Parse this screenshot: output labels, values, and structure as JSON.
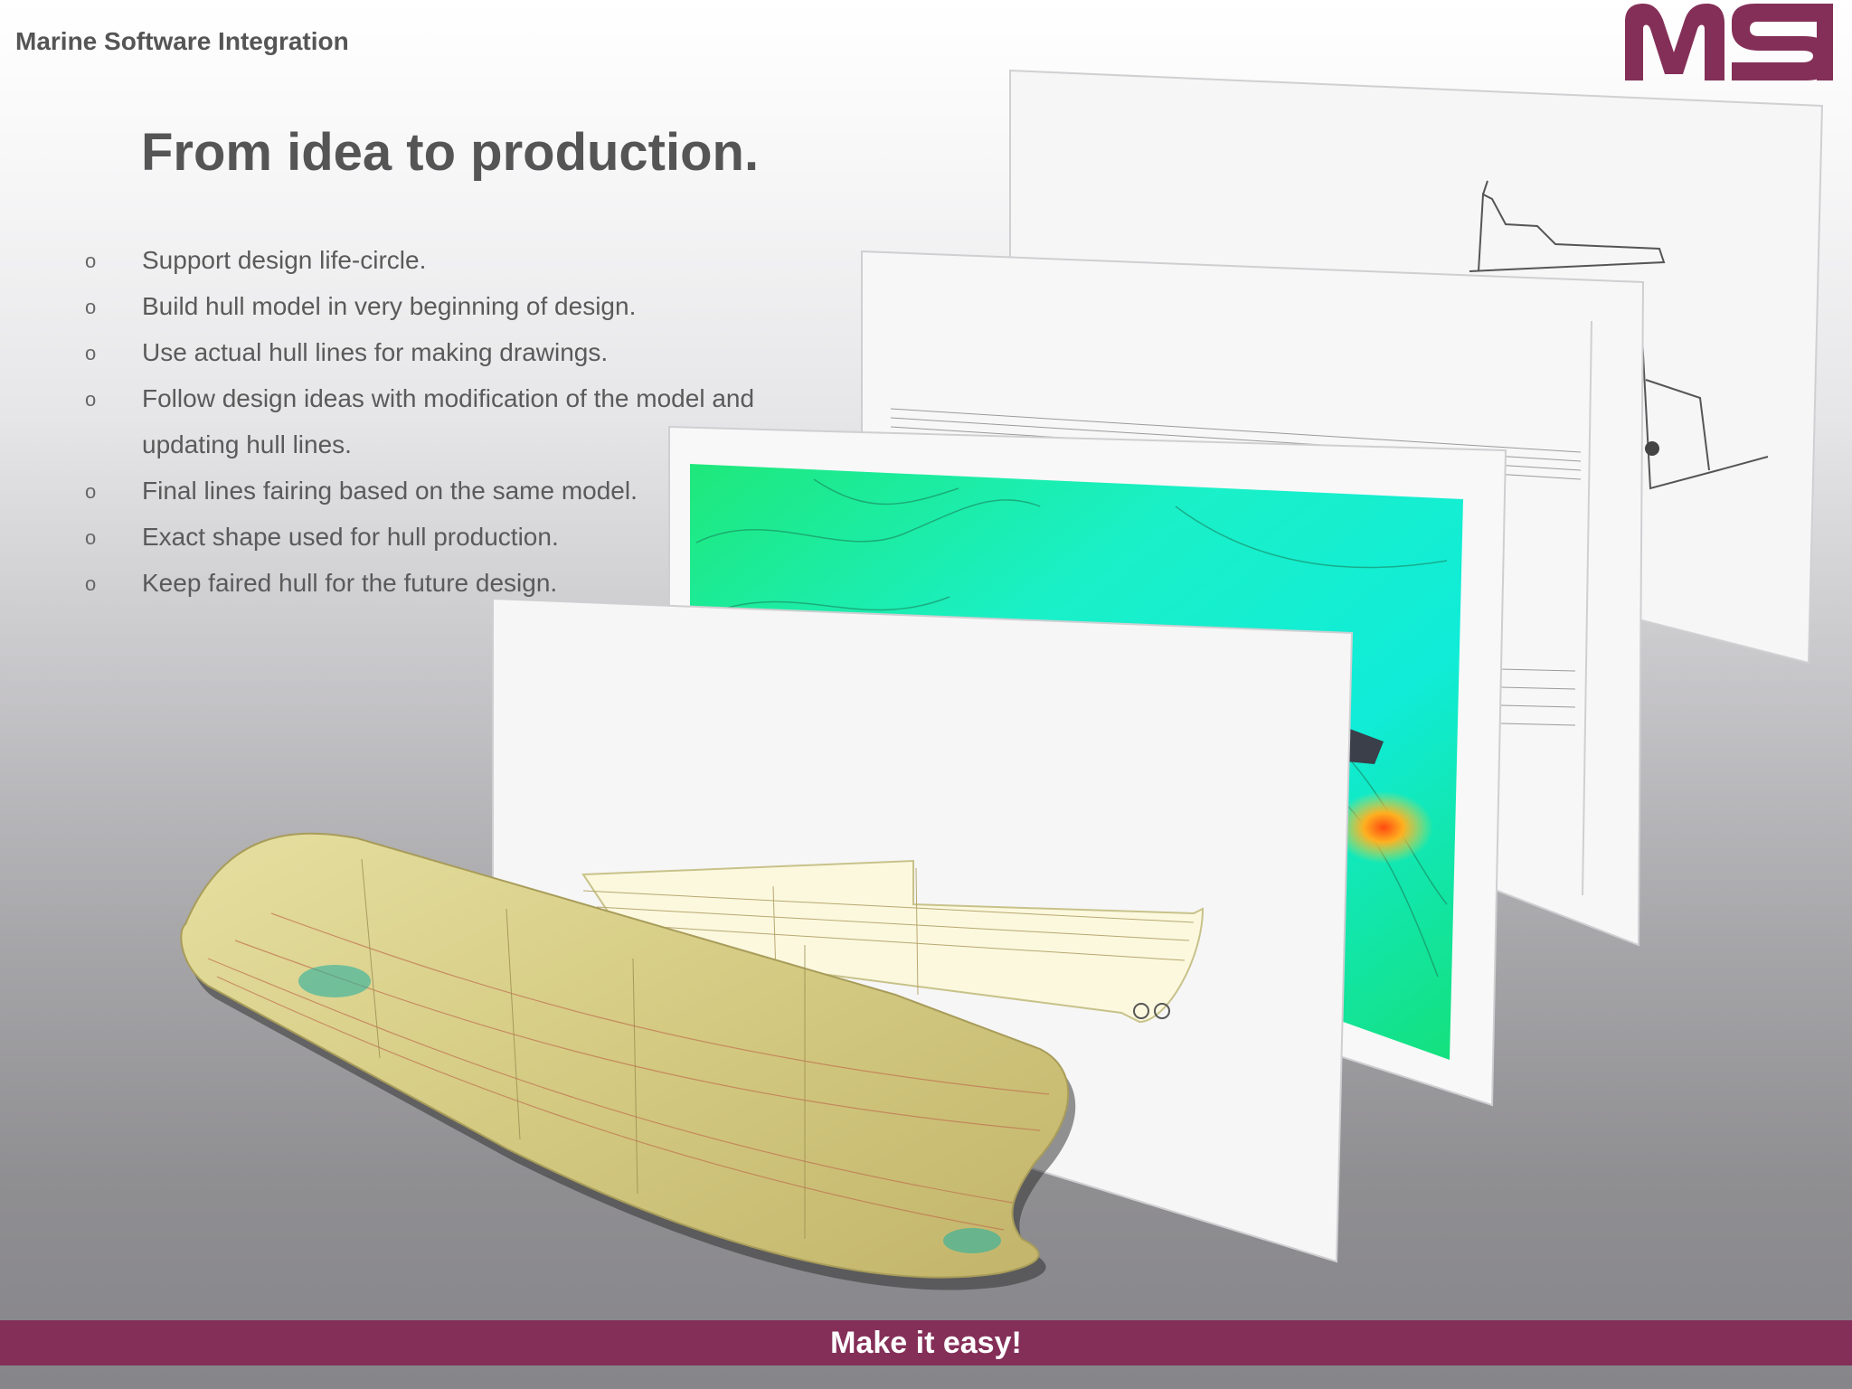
{
  "header": {
    "company": "Marine Software Integration"
  },
  "title": "From idea to production.",
  "bullets": [
    {
      "text": "Support design life-circle."
    },
    {
      "text": "Build hull model in very beginning of design."
    },
    {
      "text": "Use actual hull lines for making drawings."
    },
    {
      "text": "Follow design ideas with modification of the model and"
    },
    {
      "text": "updating hull lines.",
      "continuation": true
    },
    {
      "text": "Final lines fairing based on the same model."
    },
    {
      "text": "Exact shape used for hull production."
    },
    {
      "text": "Keep faired hull for the future design."
    }
  ],
  "bullet_marker": "o",
  "footer": {
    "slogan": "Make it easy!"
  },
  "colors": {
    "brand": "#842f58",
    "text": "#555555",
    "slogan_text": "#ffffff"
  },
  "icons": {
    "logo": "msi-logo"
  }
}
